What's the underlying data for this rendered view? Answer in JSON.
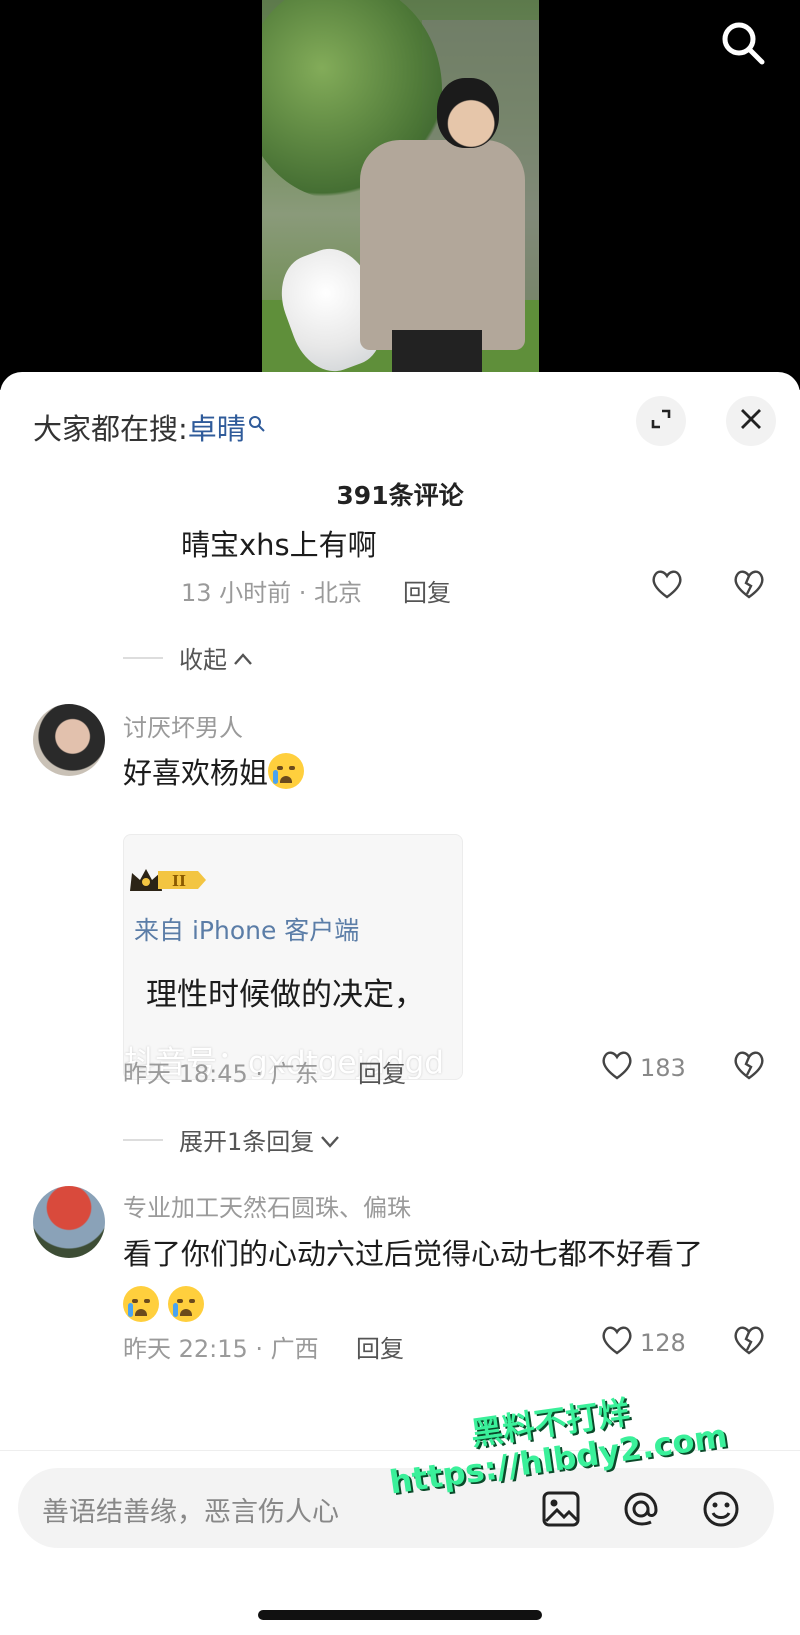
{
  "hot_search": {
    "prefix": "大家都在搜:",
    "keyword": "卓晴"
  },
  "comment_count": "391条评论",
  "reply_sub": {
    "text": "晴宝xhs上有啊",
    "meta": "13 小时前 · 北京",
    "reply_label": "回复"
  },
  "collapse_label": "收起",
  "comment1": {
    "username": "讨厌坏男人",
    "text": "好喜欢杨姐",
    "card": {
      "from": "来自 iPhone 客户端",
      "body": "理性时候做的决定，",
      "watermark": "抖音号：gxdtgejddgd"
    },
    "meta": "昨天 18:45 · 广东",
    "reply_label": "回复",
    "likes": "183",
    "expand_label": "展开1条回复"
  },
  "comment2": {
    "username": "专业加工天然石圆珠、偏珠",
    "text": "看了你们的心动六过后觉得心动七都不好看了",
    "meta": "昨天 22:15 · 广西",
    "reply_label": "回复",
    "likes": "128"
  },
  "input": {
    "placeholder": "善语结善缘，恶言伤人心"
  },
  "overlay_watermark": {
    "line1": "黑料不打烊",
    "line2": "https://hlbdy2.com"
  },
  "colors": {
    "keyword": "#2f5b9a",
    "watermark": "#3af09a"
  },
  "icons": [
    "search-icon",
    "expand-icon",
    "close-icon",
    "heart-icon",
    "broken-heart-icon",
    "image-icon",
    "at-icon",
    "emoji-icon"
  ]
}
